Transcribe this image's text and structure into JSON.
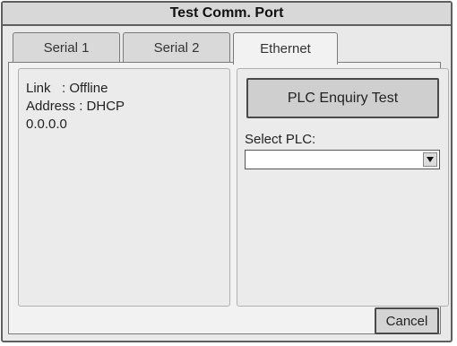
{
  "window": {
    "title": "Test Comm. Port"
  },
  "tabs": [
    {
      "label": "Serial 1",
      "active": false
    },
    {
      "label": "Serial 2",
      "active": false
    },
    {
      "label": "Ethernet",
      "active": true
    }
  ],
  "status": {
    "link_line": "Link   : Offline",
    "address_line": "Address : DHCP",
    "ip_line": "0.0.0.0"
  },
  "actions": {
    "enquiry_label": "PLC Enquiry Test",
    "select_label": "Select PLC:",
    "select_value": "",
    "cancel_label": "Cancel"
  },
  "icons": {
    "dropdown": "chevron-down-icon"
  }
}
